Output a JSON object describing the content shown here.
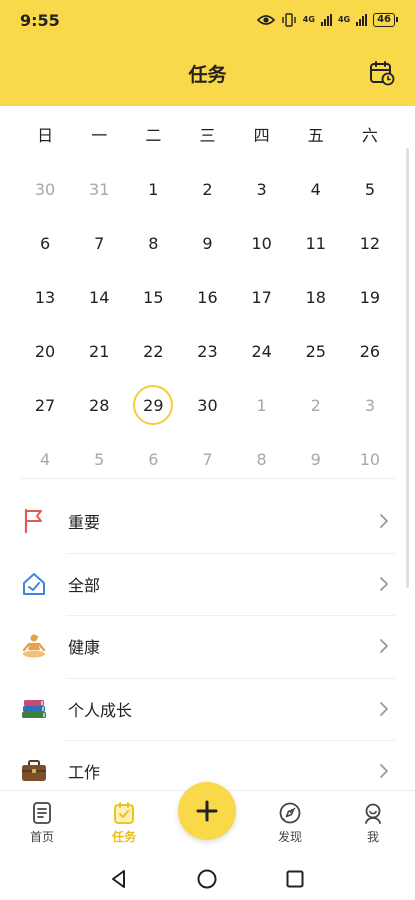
{
  "status_bar": {
    "time": "9:55",
    "net1": "4G",
    "net2": "4G",
    "battery": "46"
  },
  "header": {
    "title": "任务"
  },
  "calendar": {
    "weekdays": [
      "日",
      "一",
      "二",
      "三",
      "四",
      "五",
      "六"
    ],
    "days": [
      {
        "label": "30",
        "muted": true
      },
      {
        "label": "31",
        "muted": true
      },
      {
        "label": "1"
      },
      {
        "label": "2"
      },
      {
        "label": "3"
      },
      {
        "label": "4"
      },
      {
        "label": "5"
      },
      {
        "label": "6"
      },
      {
        "label": "7"
      },
      {
        "label": "8"
      },
      {
        "label": "9"
      },
      {
        "label": "10"
      },
      {
        "label": "11"
      },
      {
        "label": "12"
      },
      {
        "label": "13"
      },
      {
        "label": "14"
      },
      {
        "label": "15"
      },
      {
        "label": "16"
      },
      {
        "label": "17"
      },
      {
        "label": "18"
      },
      {
        "label": "19"
      },
      {
        "label": "20"
      },
      {
        "label": "21"
      },
      {
        "label": "22"
      },
      {
        "label": "23"
      },
      {
        "label": "24"
      },
      {
        "label": "25"
      },
      {
        "label": "26"
      },
      {
        "label": "27"
      },
      {
        "label": "28"
      },
      {
        "label": "29",
        "today": true
      },
      {
        "label": "30"
      },
      {
        "label": "1",
        "muted": true
      },
      {
        "label": "2",
        "muted": true
      },
      {
        "label": "3",
        "muted": true
      },
      {
        "label": "4",
        "muted": true
      },
      {
        "label": "5",
        "muted": true
      },
      {
        "label": "6",
        "muted": true
      },
      {
        "label": "7",
        "muted": true
      },
      {
        "label": "8",
        "muted": true
      },
      {
        "label": "9",
        "muted": true
      },
      {
        "label": "10",
        "muted": true
      }
    ]
  },
  "tasks": [
    {
      "label": "重要",
      "icon": "flag-icon"
    },
    {
      "label": "全部",
      "icon": "home-check-icon"
    },
    {
      "label": "健康",
      "icon": "meditation-icon"
    },
    {
      "label": "个人成长",
      "icon": "books-icon"
    },
    {
      "label": "工作",
      "icon": "briefcase-icon"
    }
  ],
  "nav": {
    "home": "首页",
    "tasks": "任务",
    "discover": "发现",
    "me": "我"
  },
  "colors": {
    "accent": "#f9d84a",
    "active_text": "#e9bf10",
    "today_ring": "#f2cf39",
    "flag": "#e05a5a",
    "home": "#3d86e0"
  }
}
